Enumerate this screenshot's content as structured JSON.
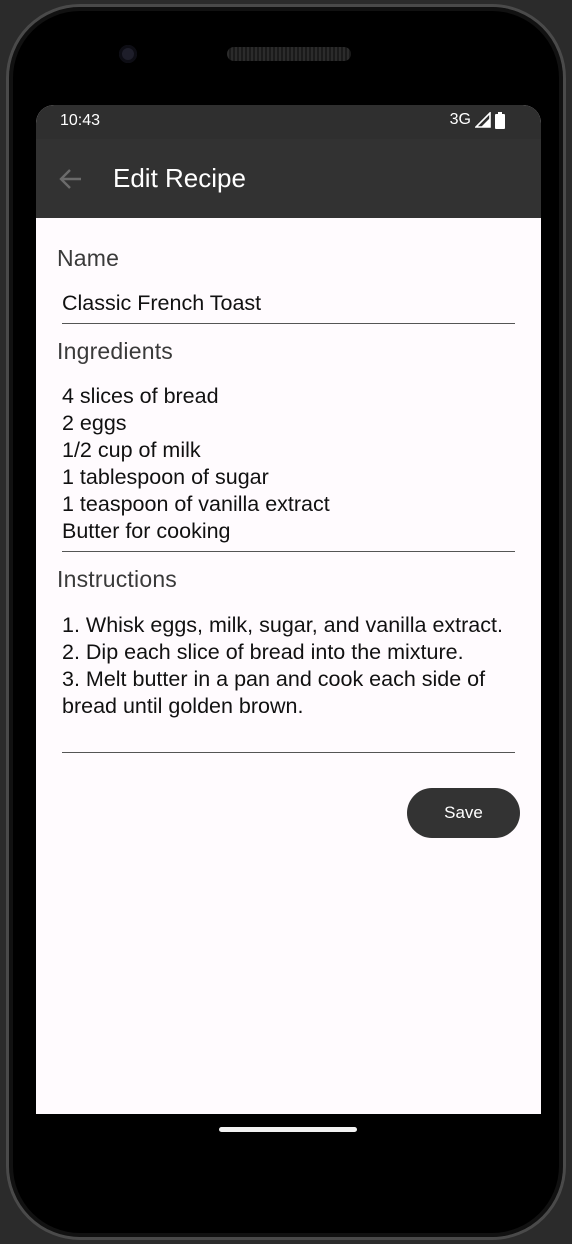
{
  "status_bar": {
    "time": "10:43",
    "network": "3G"
  },
  "app_bar": {
    "title": "Edit Recipe",
    "back_icon": "arrow-back-icon"
  },
  "form": {
    "name": {
      "label": "Name",
      "value": "Classic French Toast"
    },
    "ingredients": {
      "label": "Ingredients",
      "value": "4 slices of bread\n2 eggs\n1/2 cup of milk\n1 tablespoon of sugar\n1 teaspoon of vanilla extract\nButter for cooking"
    },
    "instructions": {
      "label": "Instructions",
      "value": "1. Whisk eggs, milk, sugar, and vanilla extract.\n2. Dip each slice of bread into the mixture.\n3. Melt butter in a pan and cook each side of bread until golden brown."
    },
    "save_label": "Save"
  },
  "colors": {
    "app_bar": "#323232",
    "status_bar": "#2f2f2f",
    "background": "#fffbfe",
    "button": "#333333"
  }
}
